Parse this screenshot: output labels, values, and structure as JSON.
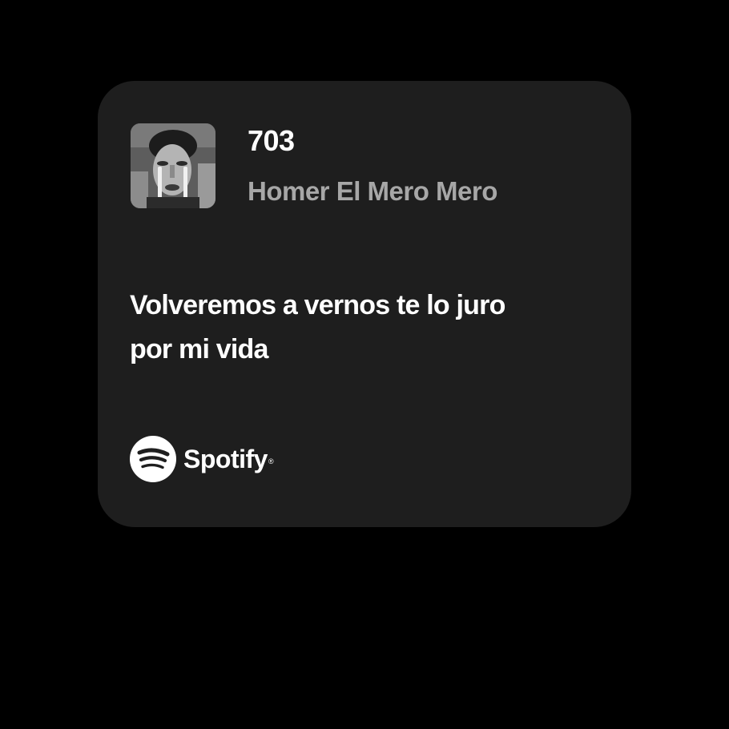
{
  "track": {
    "title": "703",
    "artist": "Homer El Mero Mero",
    "cover_icon": "album-cover-photo"
  },
  "lyrics": {
    "line1": "Volveremos a vernos te lo juro",
    "line2": "por mi vida"
  },
  "brand": {
    "name": "Spotify",
    "trademark": "®",
    "icon": "spotify-logo-icon"
  },
  "colors": {
    "page_background": "#000000",
    "card_background": "#1e1e1e",
    "title_text": "#ffffff",
    "artist_text": "#a7a7a7"
  }
}
